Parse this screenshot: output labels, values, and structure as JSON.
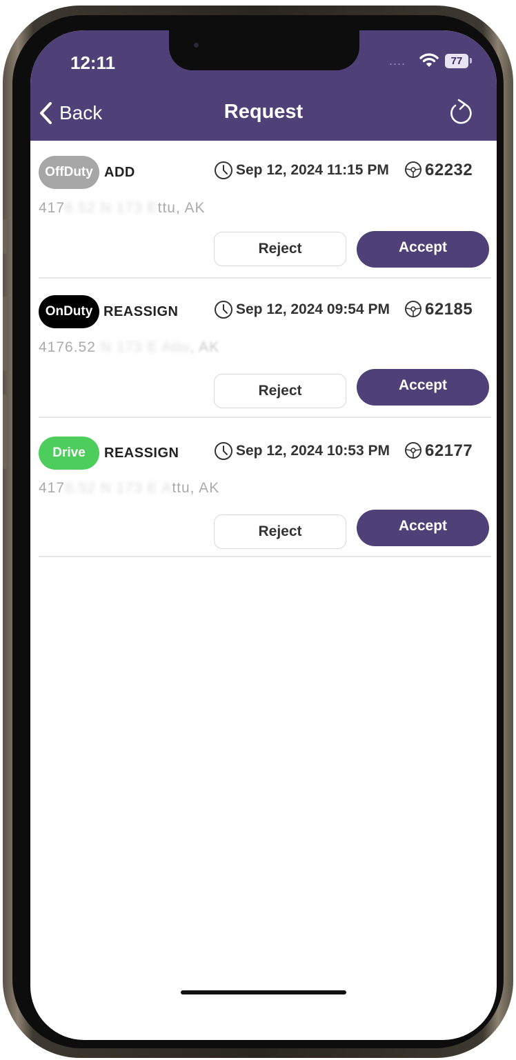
{
  "status_bar": {
    "time": "12:11",
    "signal_dots": "....",
    "battery_level": "77"
  },
  "nav": {
    "back_label": "Back",
    "title": "Request"
  },
  "requests": [
    {
      "status": "OffDuty",
      "status_color": "#a6a6a6",
      "type": "ADD",
      "datetime": "Sep 12, 2024 11:15 PM",
      "driver_id": "62232",
      "address_visible": "417",
      "address_blurred": "6.52 N 173 E",
      "address_suffix": "ttu, AK",
      "reject_label": "Reject",
      "accept_label": "Accept"
    },
    {
      "status": "OnDuty",
      "status_color": "#000000",
      "type": "REASSIGN",
      "datetime": "Sep 12, 2024 09:54 PM",
      "driver_id": "62185",
      "address_visible": "4176.52",
      "address_blurred": " N 173 E Attu",
      "address_suffix": ", AK",
      "reject_label": "Reject",
      "accept_label": "Accept"
    },
    {
      "status": "Drive",
      "status_color": "#4ccd5c",
      "type": "REASSIGN",
      "datetime": "Sep 12, 2024 10:53 PM",
      "driver_id": "62177",
      "address_visible": "417",
      "address_blurred": "6.52 N 173 E A",
      "address_suffix": "ttu, AK",
      "reject_label": "Reject",
      "accept_label": "Accept"
    }
  ],
  "colors": {
    "header_bg": "#4f4078",
    "accept_bg": "#4f4078"
  },
  "icons": {
    "back": "chevron-left-icon",
    "refresh": "refresh-icon",
    "clock": "clock-icon",
    "driver": "steering-wheel-icon",
    "wifi": "wifi-icon",
    "battery": "battery-icon"
  }
}
